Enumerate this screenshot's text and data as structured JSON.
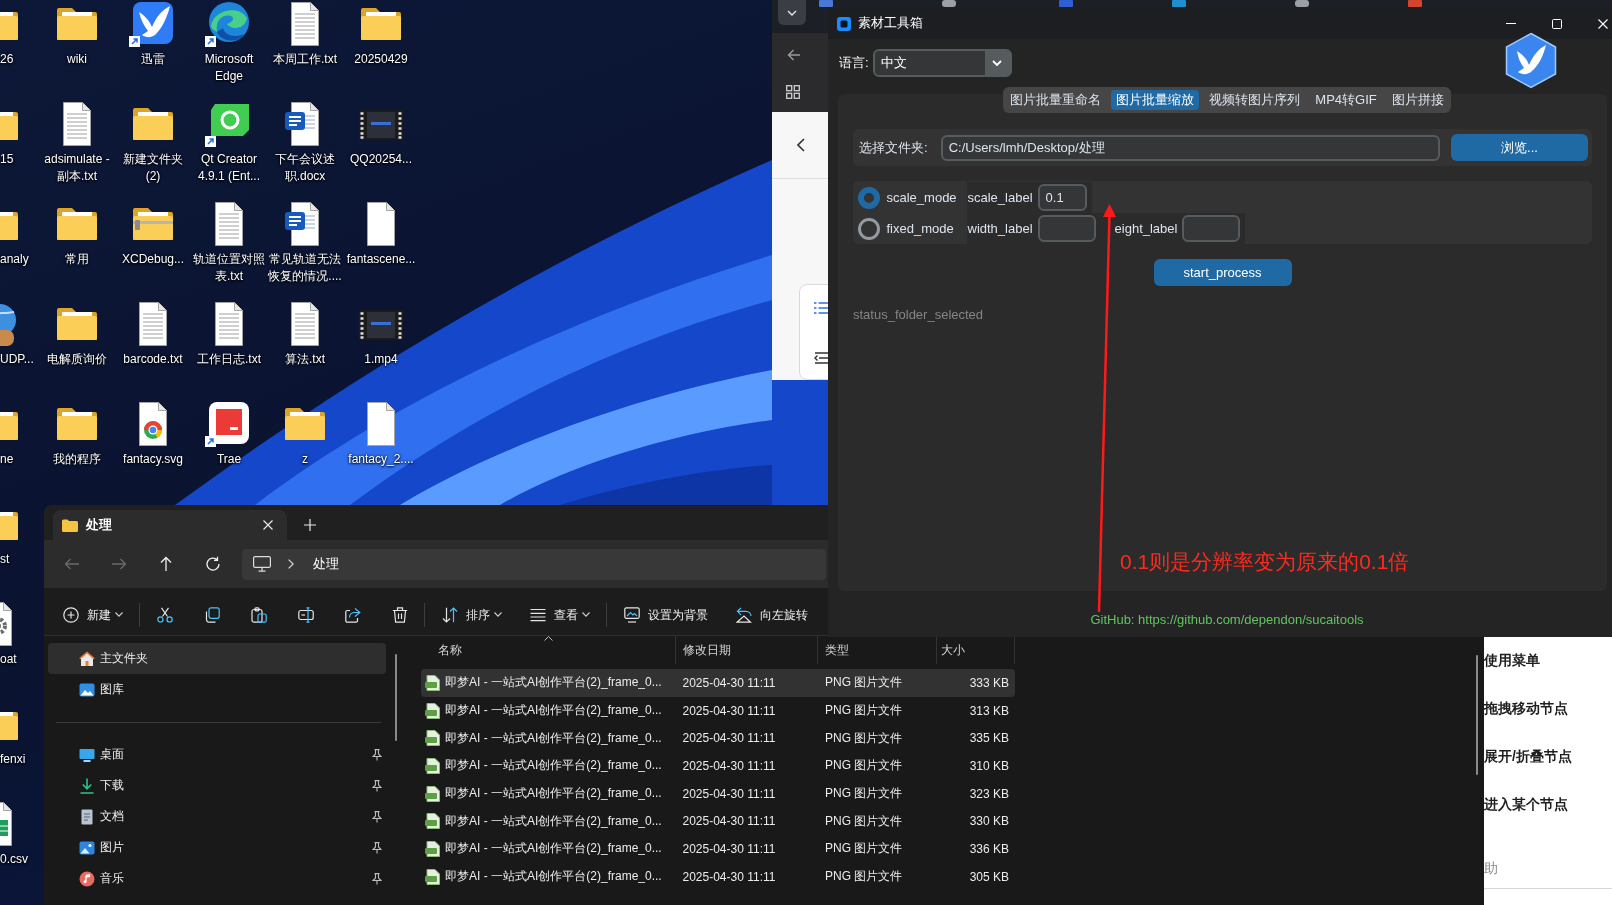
{
  "desktop": {
    "columns": [
      [
        {
          "label": "26",
          "kind": "folder",
          "shortcut": false
        },
        {
          "label": "15",
          "kind": "folder",
          "shortcut": false
        },
        {
          "label": "analy",
          "kind": "folder",
          "shortcut": false
        },
        {
          "label": "UDP...",
          "kind": "globe",
          "shortcut": false
        },
        {
          "label": "ne",
          "kind": "folder",
          "shortcut": false
        },
        {
          "label": "st",
          "kind": "folder",
          "shortcut": false
        },
        {
          "label": "oat",
          "kind": "gear",
          "shortcut": false
        },
        {
          "label": "fenxi",
          "kind": "folder",
          "shortcut": false
        },
        {
          "label": "0.csv",
          "kind": "sheet",
          "shortcut": false
        }
      ],
      [
        {
          "label": "wiki",
          "kind": "folder",
          "shortcut": false
        },
        {
          "label": "adsimulate - 副本.txt",
          "kind": "text",
          "shortcut": false
        },
        {
          "label": "常用",
          "kind": "folder",
          "shortcut": false
        },
        {
          "label": "电解质询价",
          "kind": "folder",
          "shortcut": false
        },
        {
          "label": "我的程序",
          "kind": "folder",
          "shortcut": false
        }
      ],
      [
        {
          "label": "迅雷",
          "kind": "bird",
          "shortcut": true
        },
        {
          "label": "新建文件夹 (2)",
          "kind": "folder",
          "shortcut": false
        },
        {
          "label": "XCDebug...",
          "kind": "archive",
          "shortcut": false
        },
        {
          "label": "barcode.txt",
          "kind": "text",
          "shortcut": false
        },
        {
          "label": "fantacy.svg",
          "kind": "vector",
          "shortcut": false
        }
      ],
      [
        {
          "label": "Microsoft Edge",
          "kind": "swirl",
          "shortcut": true
        },
        {
          "label": "Qt Creator 4.9.1 (Ent...",
          "kind": "tileapp",
          "shortcut": true
        },
        {
          "label": "轨道位置对照表.txt",
          "kind": "text",
          "shortcut": false
        },
        {
          "label": "工作日志.txt",
          "kind": "text",
          "shortcut": false
        },
        {
          "label": "Trae",
          "kind": "squareapp",
          "shortcut": true
        }
      ],
      [
        {
          "label": "本周工作.txt",
          "kind": "text",
          "shortcut": false
        },
        {
          "label": "下午会议述职.docx",
          "kind": "document",
          "shortcut": false
        },
        {
          "label": "常见轨道无法恢复的情况....",
          "kind": "document",
          "shortcut": false
        },
        {
          "label": "算法.txt",
          "kind": "text",
          "shortcut": false
        },
        {
          "label": "z",
          "kind": "folder",
          "shortcut": false
        }
      ],
      [
        {
          "label": "20250429",
          "kind": "folder",
          "shortcut": false
        },
        {
          "label": "QQ20254...",
          "kind": "video",
          "shortcut": false
        },
        {
          "label": "fantascene...",
          "kind": "blank",
          "shortcut": false
        },
        {
          "label": "1.mp4",
          "kind": "video",
          "shortcut": false
        },
        {
          "label": "fantacy_2....",
          "kind": "blank",
          "shortcut": false
        }
      ]
    ]
  },
  "app": {
    "title": "素材工具箱",
    "language_label": "语言:",
    "language": "中文",
    "tabs": [
      {
        "label": "图片批量重命名",
        "selected": false
      },
      {
        "label": "图片批量缩放",
        "selected": true
      },
      {
        "label": "视频转图片序列",
        "selected": false
      },
      {
        "label": "MP4转GIF",
        "selected": false
      },
      {
        "label": "图片拼接",
        "selected": false
      }
    ],
    "folder_label": "选择文件夹:",
    "folder_path": "C:/Users/lmh/Desktop/处理",
    "browse_button": "浏览...",
    "modes": [
      {
        "label": "scale_mode",
        "selected": true,
        "fields": [
          {
            "label": "scale_label",
            "value": "0.1"
          }
        ]
      },
      {
        "label": "fixed_mode",
        "selected": false,
        "fields": [
          {
            "label": "width_label"
          },
          {
            "label": "eight_label"
          }
        ]
      }
    ],
    "start_button": "start_process",
    "status": "status_folder_selected",
    "github_link": "GitHub: https://github.com/dependon/sucaitools"
  },
  "annotation": {
    "text": "0.1则是分辨率变为原来的0.1倍"
  },
  "explorer": {
    "tabs": [
      {
        "label": "处理",
        "selected": true
      }
    ],
    "nav": [
      {
        "kind": "back",
        "disabled": true
      },
      {
        "kind": "forward",
        "disabled": true
      },
      {
        "kind": "up",
        "disabled": false
      },
      {
        "kind": "refresh",
        "disabled": false
      }
    ],
    "address": {
      "crumbs": [
        "处理"
      ]
    },
    "toolbar": {
      "groups": [
        [
          {
            "kind": "new",
            "label": "新建",
            "menu": true
          }
        ],
        [
          {
            "kind": "cut",
            "menu": false
          },
          {
            "kind": "copy",
            "menu": false
          },
          {
            "kind": "paste",
            "menu": false
          },
          {
            "kind": "rename",
            "menu": false
          },
          {
            "kind": "share",
            "menu": false
          },
          {
            "kind": "delete",
            "menu": false
          }
        ],
        [
          {
            "kind": "sort",
            "label": "排序",
            "menu": true
          },
          {
            "kind": "view",
            "label": "查看",
            "menu": true
          }
        ],
        [
          {
            "kind": "background",
            "label": "设置为背景",
            "menu": false
          },
          {
            "kind": "rotate",
            "label": "向左旋转",
            "menu": false
          }
        ]
      ]
    },
    "sidebar": {
      "groups": [
        [
          {
            "kind": "home",
            "label": "主文件夹",
            "selected": true,
            "pinned": false
          },
          {
            "kind": "gallery",
            "label": "图库",
            "selected": false,
            "pinned": false
          }
        ],
        [
          {
            "kind": "desktop",
            "label": "桌面",
            "selected": false,
            "pinned": true
          },
          {
            "kind": "downloads",
            "label": "下载",
            "selected": false,
            "pinned": true
          },
          {
            "kind": "documents",
            "label": "文档",
            "selected": false,
            "pinned": true
          },
          {
            "kind": "pictures",
            "label": "图片",
            "selected": false,
            "pinned": true
          },
          {
            "kind": "music",
            "label": "音乐",
            "selected": false,
            "pinned": true
          }
        ]
      ]
    },
    "table": {
      "columns": [
        {
          "label": "名称",
          "sorted": true
        },
        {
          "label": "修改日期",
          "sorted": false
        },
        {
          "label": "类型",
          "sorted": false
        },
        {
          "label": "大小",
          "sorted": false
        }
      ],
      "rows": [
        {
          "name": "即梦AI - 一站式AI创作平台(2)_frame_0...",
          "modified": "2025-04-30 11:11",
          "type": "PNG 图片文件",
          "size": "333 KB",
          "selected": true
        },
        {
          "name": "即梦AI - 一站式AI创作平台(2)_frame_0...",
          "modified": "2025-04-30 11:11",
          "type": "PNG 图片文件",
          "size": "313 KB",
          "selected": false
        },
        {
          "name": "即梦AI - 一站式AI创作平台(2)_frame_0...",
          "modified": "2025-04-30 11:11",
          "type": "PNG 图片文件",
          "size": "335 KB",
          "selected": false
        },
        {
          "name": "即梦AI - 一站式AI创作平台(2)_frame_0...",
          "modified": "2025-04-30 11:11",
          "type": "PNG 图片文件",
          "size": "310 KB",
          "selected": false
        },
        {
          "name": "即梦AI - 一站式AI创作平台(2)_frame_0...",
          "modified": "2025-04-30 11:11",
          "type": "PNG 图片文件",
          "size": "323 KB",
          "selected": false
        },
        {
          "name": "即梦AI - 一站式AI创作平台(2)_frame_0...",
          "modified": "2025-04-30 11:11",
          "type": "PNG 图片文件",
          "size": "330 KB",
          "selected": false
        },
        {
          "name": "即梦AI - 一站式AI创作平台(2)_frame_0...",
          "modified": "2025-04-30 11:11",
          "type": "PNG 图片文件",
          "size": "336 KB",
          "selected": false
        },
        {
          "name": "即梦AI - 一站式AI创作平台(2)_frame_0...",
          "modified": "2025-04-30 11:11",
          "type": "PNG 图片文件",
          "size": "305 KB",
          "selected": false
        }
      ]
    }
  },
  "side_document": {
    "items": [
      {
        "label": "使用菜单",
        "kind": "entry"
      },
      {
        "label": "拖拽移动节点",
        "kind": "entry"
      },
      {
        "label": "展开/折叠节点",
        "kind": "entry"
      },
      {
        "label": "进入某个节点",
        "kind": "entry"
      },
      {
        "label": "助",
        "kind": "section"
      }
    ]
  }
}
